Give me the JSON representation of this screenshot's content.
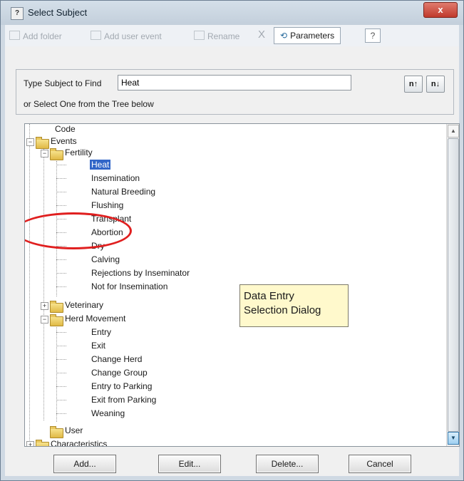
{
  "window": {
    "title": "Select Subject",
    "app_icon": "?",
    "close_label": "x"
  },
  "toolbar": {
    "add_folder": "Add folder",
    "add_user_event": "Add user event",
    "rename": "Rename",
    "delete_glyph": "X",
    "parameters": "Parameters",
    "help_glyph": "?"
  },
  "find": {
    "label": "Type Subject to Find",
    "value": "Heat",
    "select_label": "or Select One from the Tree below",
    "prev_label": "n↑",
    "next_label": "n↓"
  },
  "tree": {
    "code": "Code",
    "events": "Events",
    "fertility": "Fertility",
    "fertility_items": [
      "Heat",
      "Insemination",
      "Natural Breeding",
      "Flushing",
      "Transplant",
      "Abortion",
      "Dry",
      "Calving",
      "Rejections by Inseminator",
      "Not for Insemination"
    ],
    "selected_item": "Heat",
    "veterinary": "Veterinary",
    "herd_movement": "Herd Movement",
    "herd_items": [
      "Entry",
      "Exit",
      "Change Herd",
      "Change Group",
      "Entry to Parking",
      "Exit from Parking",
      "Weaning"
    ],
    "user": "User",
    "characteristics": "Characteristics"
  },
  "callout": {
    "line1": "Data Entry",
    "line2": "Selection Dialog"
  },
  "buttons": {
    "add": "Add...",
    "edit": "Edit...",
    "delete": "Delete...",
    "cancel": "Cancel"
  },
  "colors": {
    "selection": "#3166c8",
    "highlight_ellipse": "#e01f1f",
    "callout_bg": "#fff9cc"
  }
}
